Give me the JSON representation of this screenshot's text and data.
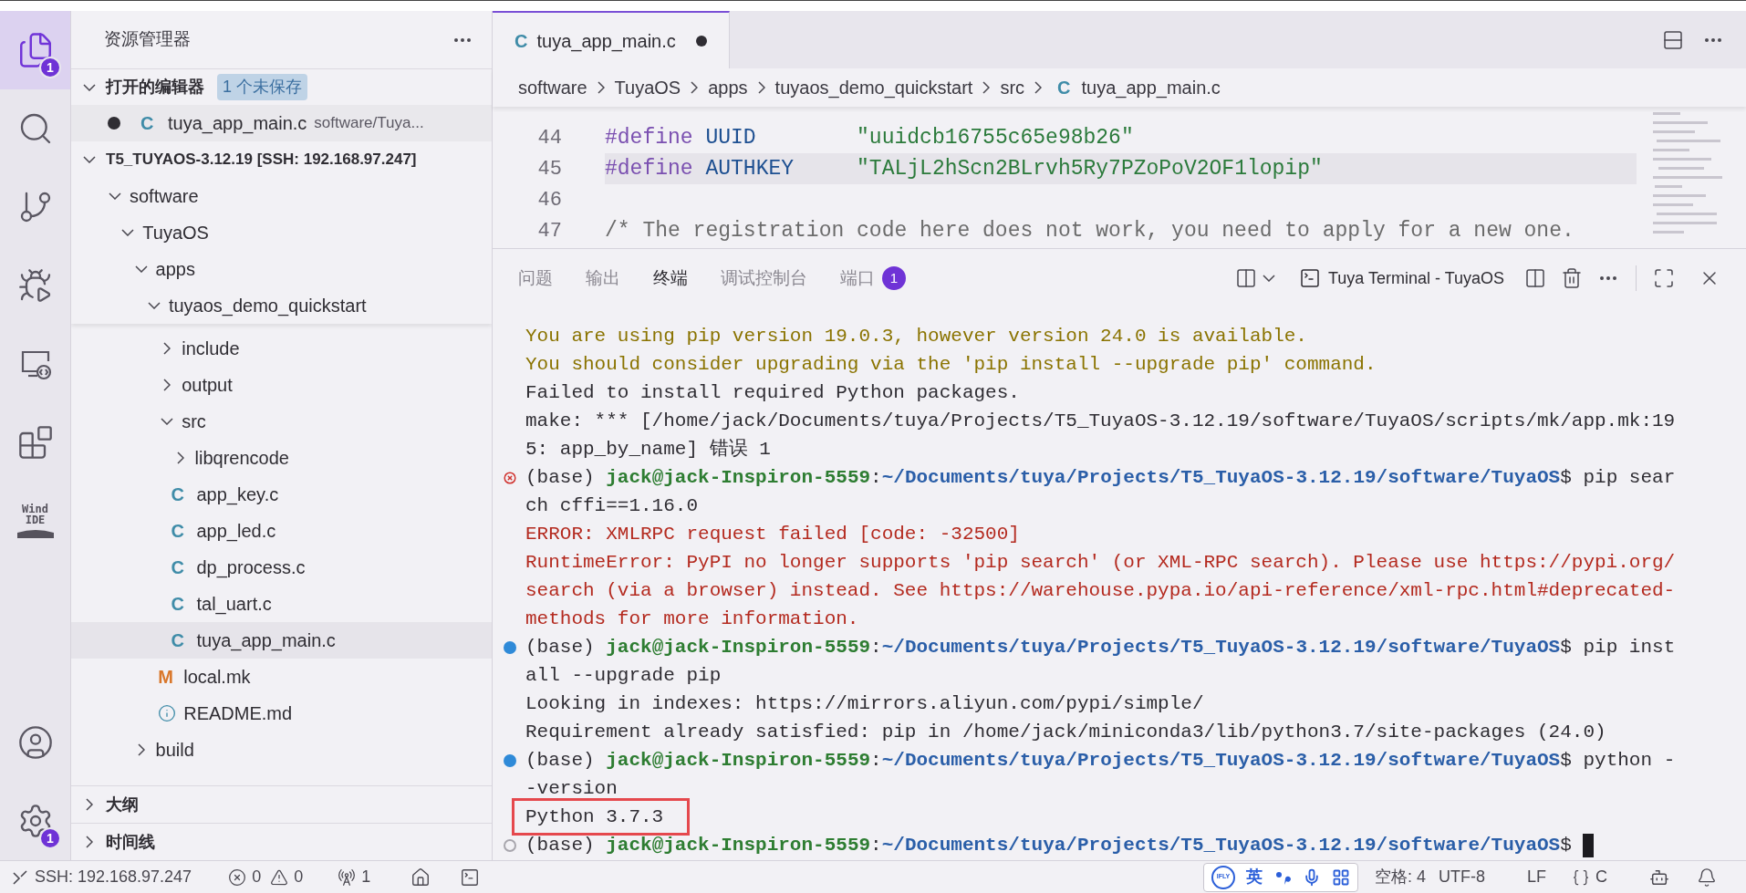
{
  "activity_bar": {
    "items": [
      {
        "kind": "explorer",
        "selected": true,
        "badge": "1"
      },
      {
        "kind": "search",
        "selected": false
      },
      {
        "kind": "source_control",
        "selected": false
      },
      {
        "kind": "run_debug",
        "selected": false
      },
      {
        "kind": "remote",
        "selected": false
      },
      {
        "kind": "extensions",
        "selected": false
      },
      {
        "kind": "logo",
        "selected": false,
        "lines": [
          "Wind",
          "IDE"
        ]
      }
    ],
    "bottom": [
      {
        "kind": "account"
      },
      {
        "kind": "settings",
        "badge": "1"
      }
    ]
  },
  "sidebar": {
    "title": "资源管理器",
    "open_editors": {
      "title": "打开的编辑器",
      "expanded": true,
      "badge": "1 个未保存",
      "items": [
        {
          "modified": true,
          "icon_text": "C",
          "name": "tuya_app_main.c",
          "path": "software/Tuya..."
        }
      ]
    },
    "workspace": {
      "title": "T5_TUYAOS-3.12.19 [SSH: 192.168.97.247]",
      "expanded": true,
      "tree": [
        {
          "label": "software",
          "kind": "folder",
          "expanded": true,
          "selected": false,
          "children": [
            {
              "label": "TuyaOS",
              "kind": "folder",
              "expanded": true,
              "selected": false,
              "children": [
                {
                  "label": "apps",
                  "kind": "folder",
                  "expanded": true,
                  "selected": false,
                  "children": [
                    {
                      "label": "tuyaos_demo_quickstart",
                      "kind": "folder",
                      "expanded": true,
                      "selected": false,
                      "children": [
                        {
                          "label": "include",
                          "kind": "folder",
                          "expanded": false,
                          "selected": false
                        },
                        {
                          "label": "output",
                          "kind": "folder",
                          "expanded": false,
                          "selected": false
                        },
                        {
                          "label": "src",
                          "kind": "folder",
                          "expanded": true,
                          "selected": false,
                          "children": [
                            {
                              "label": "libqrencode",
                              "kind": "folder",
                              "expanded": false,
                              "selected": false
                            },
                            {
                              "label": "app_key.c",
                              "kind": "c",
                              "icon_text": "C",
                              "selected": false
                            },
                            {
                              "label": "app_led.c",
                              "kind": "c",
                              "icon_text": "C",
                              "selected": false
                            },
                            {
                              "label": "dp_process.c",
                              "kind": "c",
                              "icon_text": "C",
                              "selected": false
                            },
                            {
                              "label": "tal_uart.c",
                              "kind": "c",
                              "icon_text": "C",
                              "selected": false
                            },
                            {
                              "label": "tuya_app_main.c",
                              "kind": "c",
                              "icon_text": "C",
                              "selected": true
                            }
                          ]
                        },
                        {
                          "label": "local.mk",
                          "kind": "make",
                          "icon_text": "M",
                          "selected": false
                        },
                        {
                          "label": "README.md",
                          "kind": "info",
                          "selected": false
                        }
                      ]
                    }
                  ]
                },
                {
                  "label": "build",
                  "kind": "folder",
                  "expanded": false,
                  "selected": false
                }
              ]
            }
          ]
        }
      ]
    },
    "sections": [
      {
        "title": "大纲",
        "expanded": false
      },
      {
        "title": "时间线",
        "expanded": false
      }
    ]
  },
  "editor": {
    "tabs": [
      {
        "icon_text": "C",
        "label": "tuya_app_main.c",
        "modified": true,
        "selected": true
      }
    ],
    "breadcrumb": [
      {
        "label": "software"
      },
      {
        "label": "TuyaOS"
      },
      {
        "label": "apps"
      },
      {
        "label": "tuyaos_demo_quickstart"
      },
      {
        "label": "src"
      },
      {
        "label": "tuya_app_main.c",
        "icon_text": "C"
      }
    ],
    "lines": [
      {
        "number": "44",
        "current": false,
        "tokens": [
          {
            "kind": "keyword",
            "text": "#define"
          },
          {
            "kind": "macro",
            "text": " UUID        "
          },
          {
            "kind": "string",
            "text": "\"uuidcb16755c65e98b26\""
          }
        ]
      },
      {
        "number": "45",
        "current": true,
        "tokens": [
          {
            "kind": "keyword",
            "text": "#define"
          },
          {
            "kind": "macro",
            "text": " AUTHKEY     "
          },
          {
            "kind": "string",
            "text": "\"TALjL2hScn2BLrvh5Ry7PZoPoV2OF1lopip\""
          }
        ]
      },
      {
        "number": "46",
        "current": false
      },
      {
        "number": "47",
        "current": false,
        "tokens": [
          {
            "kind": "comment",
            "text": "/* The registration code here does not work, you need to apply for a new one."
          }
        ]
      }
    ]
  },
  "panel": {
    "tabs": [
      {
        "label": "问题",
        "selected": false
      },
      {
        "label": "输出",
        "selected": false
      },
      {
        "label": "终端",
        "selected": true
      },
      {
        "label": "调试控制台",
        "selected": false
      },
      {
        "label": "端口",
        "selected": false,
        "badge": "1"
      }
    ],
    "terminal_name": "Tuya Terminal - TuyaOS",
    "lines": [
      {
        "kind": "warning",
        "text": "You are using pip version 19.0.3, however version 24.0 is available."
      },
      {
        "kind": "warning",
        "text": "You should consider upgrading via the 'pip install --upgrade pip' command."
      },
      {
        "kind": "plain",
        "text": "Failed to install required Python packages."
      },
      {
        "kind": "plain",
        "text": "make: *** [/home/jack/Documents/tuya/Projects/T5_TuyaOS-3.12.19/software/TuyaOS/scripts/mk/app.mk:19"
      },
      {
        "kind": "plain",
        "text": "5: app_by_name] 错误 1"
      },
      {
        "kind": "prompt",
        "marker": {
          "kind": "error"
        },
        "env": "(base)",
        "user": "jack@jack-Inspiron-5559",
        "sep": ":",
        "path": "~/Documents/tuya/Projects/T5_TuyaOS-3.12.19/software/TuyaOS",
        "dollar": "$",
        "command": "pip sear"
      },
      {
        "kind": "plain",
        "text": "ch cffi==1.16.0"
      },
      {
        "kind": "error",
        "text": "ERROR: XMLRPC request failed [code: -32500]"
      },
      {
        "kind": "error",
        "text": "RuntimeError: PyPI no longer supports 'pip search' (or XML-RPC search). Please use https://pypi.org/"
      },
      {
        "kind": "error",
        "text": "search (via a browser) instead. See https://warehouse.pypa.io/api-reference/xml-rpc.html#deprecated-"
      },
      {
        "kind": "error",
        "text": "methods for more information."
      },
      {
        "kind": "prompt",
        "marker": {
          "kind": "success"
        },
        "env": "(base)",
        "user": "jack@jack-Inspiron-5559",
        "sep": ":",
        "path": "~/Documents/tuya/Projects/T5_TuyaOS-3.12.19/software/TuyaOS",
        "dollar": "$",
        "command": "pip inst"
      },
      {
        "kind": "plain",
        "text": "all --upgrade pip"
      },
      {
        "kind": "plain",
        "text": "Looking in indexes: https://mirrors.aliyun.com/pypi/simple/"
      },
      {
        "kind": "plain",
        "text": "Requirement already satisfied: pip in /home/jack/miniconda3/lib/python3.7/site-packages (24.0)"
      },
      {
        "kind": "prompt",
        "marker": {
          "kind": "success"
        },
        "env": "(base)",
        "user": "jack@jack-Inspiron-5559",
        "sep": ":",
        "path": "~/Documents/tuya/Projects/T5_TuyaOS-3.12.19/software/TuyaOS",
        "dollar": "$",
        "command": "python -"
      },
      {
        "kind": "plain",
        "text": "-version"
      },
      {
        "kind": "boxed",
        "text": "Python 3.7.3"
      },
      {
        "kind": "prompt",
        "marker": {
          "kind": "idle"
        },
        "env": "(base)",
        "user": "jack@jack-Inspiron-5559",
        "sep": ":",
        "path": "~/Documents/tuya/Projects/T5_TuyaOS-3.12.19/software/TuyaOS",
        "dollar": "$",
        "cursor": true
      }
    ]
  },
  "status_bar": {
    "remote": "SSH: 192.168.97.247",
    "errors": "0",
    "warnings": "0",
    "ports": "1",
    "ime": {
      "logo": "IFLY",
      "mode": "英"
    },
    "indent": "空格: 4",
    "encoding": "UTF-8",
    "eol": "LF",
    "language": "C"
  }
}
